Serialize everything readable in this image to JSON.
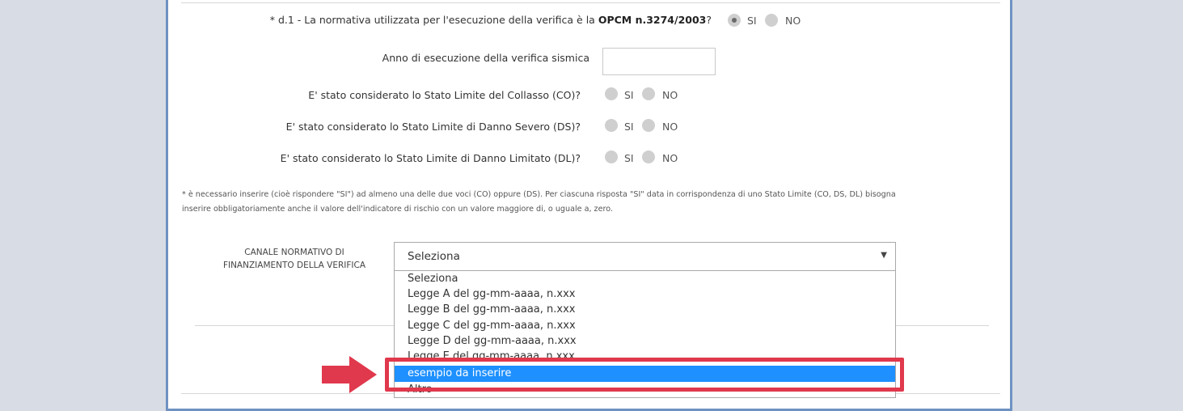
{
  "questions": {
    "d1": {
      "label_prefix": "* d.1 - La normativa utilizzata per l'esecuzione della verifica è la ",
      "label_bold": "OPCM n.3274/2003",
      "label_suffix": "?",
      "selected": "SI"
    },
    "anno": {
      "label": "Anno di esecuzione della verifica sismica",
      "value": ""
    },
    "co": {
      "label": "E' stato considerato lo Stato Limite del Collasso (CO)?"
    },
    "ds": {
      "label": "E' stato considerato lo Stato Limite di Danno Severo (DS)?"
    },
    "dl": {
      "label": "E' stato considerato lo Stato Limite di Danno Limitato (DL)?"
    }
  },
  "radio_labels": {
    "si": "SI",
    "no": "NO"
  },
  "note": {
    "line1": "* è necessario inserire (cioè rispondere \"SI\") ad almeno una delle due voci (CO) oppure (DS). Per ciascuna risposta \"SI\" data in corrispondenza di uno Stato Limite (CO, DS, DL) bisogna",
    "line2": "inserire obbligatoriamente anche il valore dell'indicatore di rischio con un valore maggiore di, o uguale a, zero."
  },
  "canale": {
    "label_line1": "CANALE NORMATIVO DI",
    "label_line2": "FINANZIAMENTO DELLA VERIFICA",
    "selected_value": "Seleziona",
    "options": [
      "Seleziona",
      "Legge A del gg-mm-aaaa, n.xxx",
      "Legge B del gg-mm-aaaa, n.xxx",
      "Legge C del gg-mm-aaaa, n.xxx",
      "Legge D del gg-mm-aaaa, n.xxx",
      "Legge E del gg-mm-aaaa, n.xxx",
      "esempio da inserire",
      "Altro"
    ],
    "highlighted_option": "esempio da inserire"
  },
  "colors": {
    "page_bg": "#d7dce5",
    "panel_border": "#6f92c2",
    "highlight_border": "#e0384c",
    "selected_option_bg": "#1e90ff",
    "arrow": "#e0384c"
  }
}
